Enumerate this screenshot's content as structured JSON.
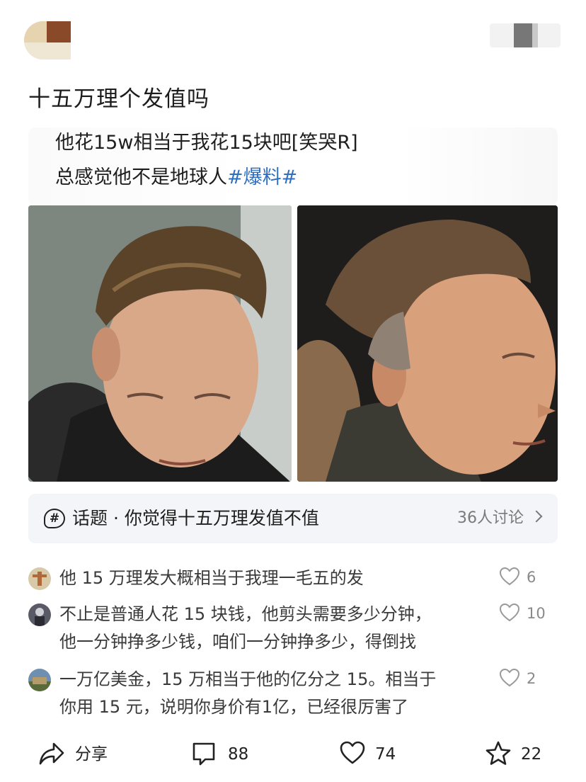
{
  "post": {
    "title": "十五万理个发值吗",
    "quote": {
      "line1": "他花15w相当于我花15块吧[笑哭R]",
      "line2_text": "总感觉他不是地球人",
      "line2_hashtag": "#爆料#"
    }
  },
  "topic": {
    "label": "话题 · 你觉得十五万理发值不值",
    "count": "36人讨论"
  },
  "comments": [
    {
      "line1": "他 15 万理发大概相当于我理一毛五的发",
      "line2": "",
      "likes": "6"
    },
    {
      "line1": "不止是普通人花 15 块钱，他剪头需要多少分钟，",
      "line2": "他一分钟挣多少钱，咱们一分钟挣多少，得倒找",
      "likes": "10"
    },
    {
      "line1": "一万亿美金，15 万相当于他的亿分之 15。相当于",
      "line2": "你用 15 元，说明你身价有1亿，已经很厉害了",
      "likes": "2"
    }
  ],
  "actions": {
    "share_label": "分享",
    "comment_count": "88",
    "like_count": "74",
    "star_count": "22"
  },
  "colors": {
    "hashtag": "#2f6fbf",
    "topic_bg": "#f3f5f8"
  }
}
